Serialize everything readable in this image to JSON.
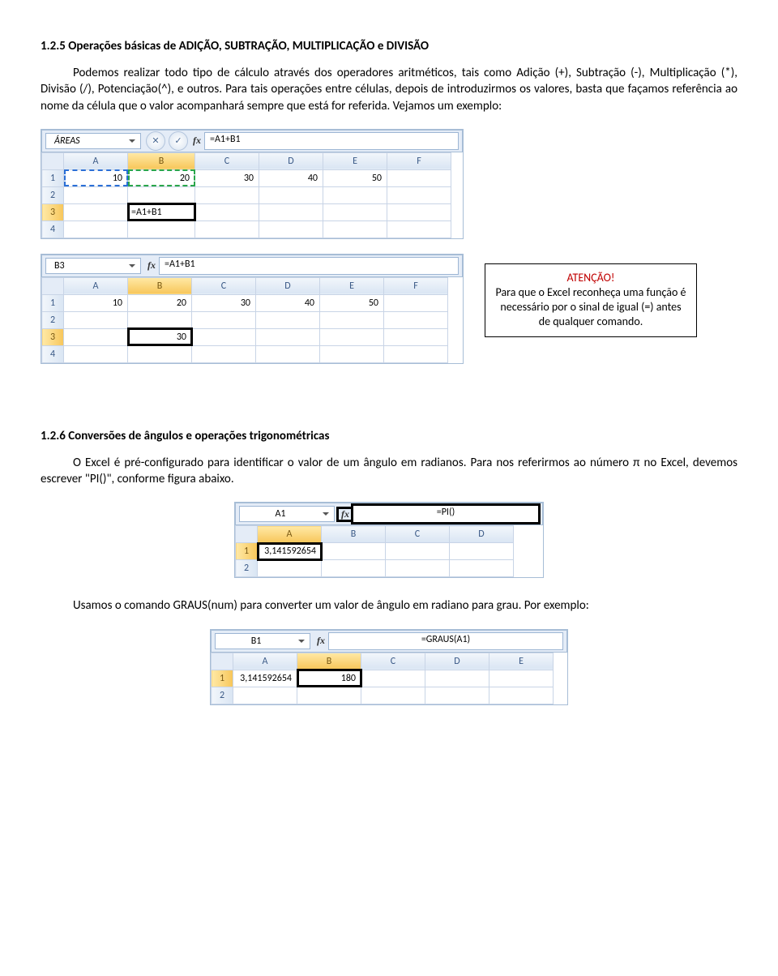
{
  "section1": {
    "heading": "1.2.5 Operações básicas de ADIÇÃO, SUBTRAÇÃO, MULTIPLICAÇÃO e DIVISÃO",
    "para": "Podemos realizar todo tipo de cálculo através dos operadores aritméticos, tais como Adição (+), Subtração (-), Multiplicação (*), Divisão (/), Potenciação(^), e outros. Para tais operações entre células, depois de introduzirmos os valores, basta que façamos referência ao nome da célula que o valor acompanhará sempre que está for referida. Vejamos um exemplo:"
  },
  "screenshot1": {
    "namebox": "ÁREAS",
    "formula": "=A1+B1",
    "cols": [
      "A",
      "B",
      "C",
      "D",
      "E",
      "F"
    ],
    "rows": [
      "1",
      "2",
      "3",
      "4"
    ],
    "r1": {
      "A": "10",
      "B": "20",
      "C": "30",
      "D": "40",
      "E": "50"
    },
    "r3B": "=A1+B1"
  },
  "callout": {
    "title": "ATENÇÃO!",
    "body": "Para que o Excel reconheça uma função é necessário por o sinal de igual (=) antes de qualquer comando."
  },
  "screenshot2": {
    "namebox": "B3",
    "formula": "=A1+B1",
    "cols": [
      "A",
      "B",
      "C",
      "D",
      "E",
      "F"
    ],
    "rows": [
      "1",
      "2",
      "3",
      "4"
    ],
    "r1": {
      "A": "10",
      "B": "20",
      "C": "30",
      "D": "40",
      "E": "50"
    },
    "r3B": "30"
  },
  "section2": {
    "heading": "1.2.6 Conversões de ângulos e operações trigonométricas",
    "para": "O Excel é pré-configurado para identificar o valor de um ângulo em radianos. Para nos referirmos ao número π no Excel, devemos escrever \"PI()\", conforme figura abaixo."
  },
  "screenshot3": {
    "namebox": "A1",
    "formula": "=PI()",
    "cols": [
      "A",
      "B",
      "C",
      "D"
    ],
    "rows": [
      "1",
      "2"
    ],
    "r1A": "3,141592654"
  },
  "section3": {
    "para": "Usamos o comando GRAUS(num) para converter um valor de ângulo em radiano para grau. Por exemplo:"
  },
  "screenshot4": {
    "namebox": "B1",
    "formula": "=GRAUS(A1)",
    "cols": [
      "A",
      "B",
      "C",
      "D",
      "E"
    ],
    "rows": [
      "1",
      "2"
    ],
    "r1A": "3,141592654",
    "r1B": "180"
  },
  "icons": {
    "cancel": "✕",
    "enter": "✓",
    "fx": "fx"
  }
}
